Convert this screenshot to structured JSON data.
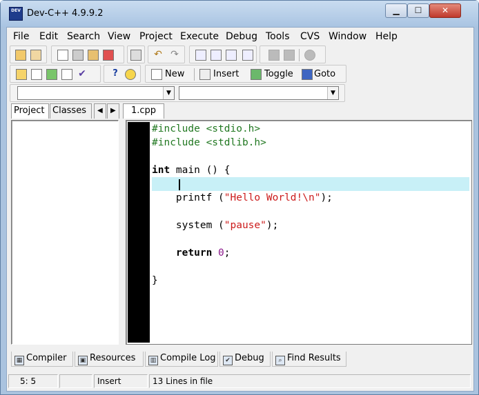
{
  "window": {
    "title": "Dev-C++ 4.9.9.2",
    "icon_text": "DEV"
  },
  "caption_buttons": {
    "minimize": "▁",
    "maximize": "☐",
    "close": "✕"
  },
  "menu": [
    "File",
    "Edit",
    "Search",
    "View",
    "Project",
    "Execute",
    "Debug",
    "Tools",
    "CVS",
    "Window",
    "Help"
  ],
  "toolbar": {
    "new_label": "New",
    "insert_label": "Insert",
    "toggle_label": "Toggle",
    "goto_label": "Goto"
  },
  "combos": {
    "class_value": "",
    "member_value": ""
  },
  "left_tabs": [
    "Project",
    "Classes"
  ],
  "editor_tab": "1.cpp",
  "code_lines": [
    {
      "parts": [
        {
          "t": "#include <stdio.h>",
          "c": "pp"
        }
      ]
    },
    {
      "parts": [
        {
          "t": "#include <stdlib.h>",
          "c": "pp"
        }
      ]
    },
    {
      "parts": []
    },
    {
      "parts": [
        {
          "t": "int",
          "c": "kw"
        },
        {
          "t": " main () {",
          "c": ""
        }
      ]
    },
    {
      "parts": [],
      "current": true
    },
    {
      "parts": [
        {
          "t": "    printf (",
          "c": ""
        },
        {
          "t": "\"Hello World!\\n\"",
          "c": "str"
        },
        {
          "t": ");",
          "c": ""
        }
      ]
    },
    {
      "parts": []
    },
    {
      "parts": [
        {
          "t": "    system (",
          "c": ""
        },
        {
          "t": "\"pause\"",
          "c": "str"
        },
        {
          "t": ");",
          "c": ""
        }
      ]
    },
    {
      "parts": []
    },
    {
      "parts": [
        {
          "t": "    ",
          "c": ""
        },
        {
          "t": "return",
          "c": "kw"
        },
        {
          "t": " ",
          "c": ""
        },
        {
          "t": "0",
          "c": "num"
        },
        {
          "t": ";",
          "c": ""
        }
      ]
    },
    {
      "parts": []
    },
    {
      "parts": [
        {
          "t": "}",
          "c": ""
        }
      ]
    },
    {
      "parts": []
    }
  ],
  "bottom_tabs": [
    {
      "label": "Compiler",
      "icon": "compiler-icon"
    },
    {
      "label": "Resources",
      "icon": "resources-icon"
    },
    {
      "label": "Compile Log",
      "icon": "compile-log-icon"
    },
    {
      "label": "Debug",
      "icon": "debug-icon"
    },
    {
      "label": "Find Results",
      "icon": "find-results-icon"
    }
  ],
  "status": {
    "position": "5: 5",
    "blank": "",
    "mode": "Insert",
    "info": "13 Lines in file"
  },
  "colors": {
    "preprocessor": "#217821",
    "string": "#cc1b1b",
    "number": "#8a188a",
    "current_line": "#c8f0f7",
    "gutter": "#000000"
  }
}
